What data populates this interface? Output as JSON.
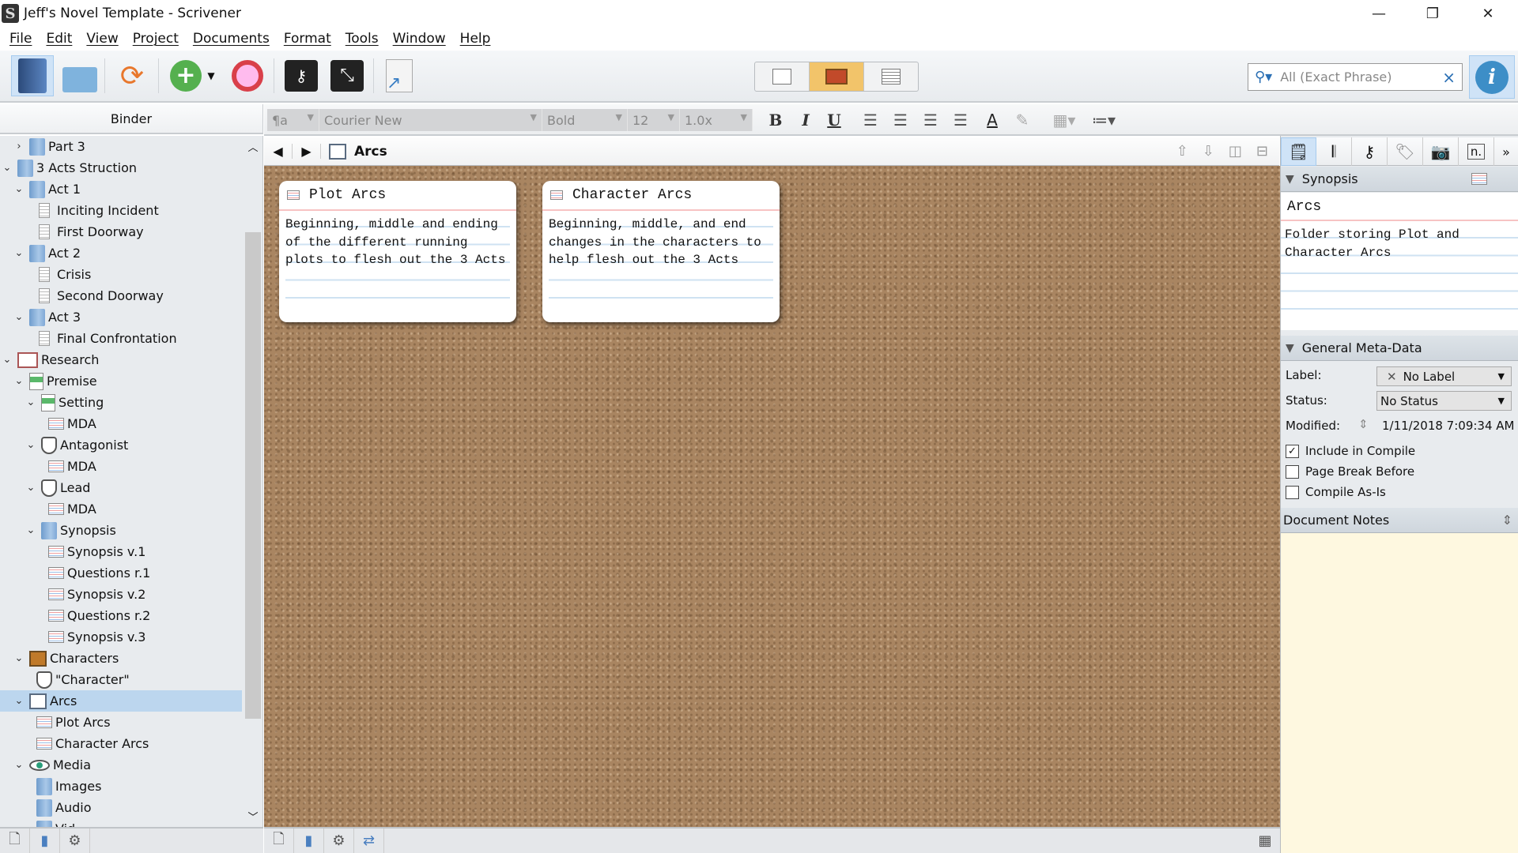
{
  "window": {
    "title": "Jeff's Novel Template - Scrivener",
    "minimize": "—",
    "restore": "❐",
    "close": "✕"
  },
  "menu": [
    "File",
    "Edit",
    "View",
    "Project",
    "Documents",
    "Format",
    "Tools",
    "Window",
    "Help"
  ],
  "toolbar": {
    "search_placeholder": "All (Exact Phrase)",
    "search_clear": "×",
    "info": "i"
  },
  "binder": {
    "header": "Binder",
    "items": [
      {
        "label": "Part 3",
        "level": 1,
        "arrow": ">",
        "icon": "folder"
      },
      {
        "label": "3 Acts Struction",
        "level": 0,
        "arrow": "v",
        "icon": "folder"
      },
      {
        "label": "Act 1",
        "level": 1,
        "arrow": "v",
        "icon": "folder"
      },
      {
        "label": "Inciting Incident",
        "level": 2,
        "icon": "doc"
      },
      {
        "label": "First Doorway",
        "level": 2,
        "icon": "doc"
      },
      {
        "label": "Act 2",
        "level": 1,
        "arrow": "v",
        "icon": "folder"
      },
      {
        "label": "Crisis",
        "level": 2,
        "icon": "doc"
      },
      {
        "label": "Second Doorway",
        "level": 2,
        "icon": "doc"
      },
      {
        "label": "Act 3",
        "level": 1,
        "arrow": "v",
        "icon": "folder"
      },
      {
        "label": "Final Confrontation",
        "level": 2,
        "icon": "doc"
      },
      {
        "label": "Research",
        "level": 0,
        "arrow": "v",
        "icon": "research"
      },
      {
        "label": "Premise",
        "level": 1,
        "arrow": "v",
        "icon": "pic"
      },
      {
        "label": "Setting",
        "level": 2,
        "arrow": "v",
        "icon": "pic"
      },
      {
        "label": "MDA",
        "level": 3,
        "icon": "card"
      },
      {
        "label": "Antagonist",
        "level": 2,
        "arrow": "v",
        "icon": "mask"
      },
      {
        "label": "MDA",
        "level": 3,
        "icon": "card"
      },
      {
        "label": "Lead",
        "level": 2,
        "arrow": "v",
        "icon": "mask"
      },
      {
        "label": "MDA",
        "level": 3,
        "icon": "card"
      },
      {
        "label": "Synopsis",
        "level": 2,
        "arrow": "v",
        "icon": "folder"
      },
      {
        "label": "Synopsis v.1",
        "level": 3,
        "icon": "card"
      },
      {
        "label": "Questions r.1",
        "level": 3,
        "icon": "card"
      },
      {
        "label": "Synopsis v.2",
        "level": 3,
        "icon": "card"
      },
      {
        "label": "Questions r.2",
        "level": 3,
        "icon": "card"
      },
      {
        "label": "Synopsis v.3",
        "level": 3,
        "icon": "card"
      },
      {
        "label": "Characters",
        "level": 1,
        "arrow": "v",
        "icon": "person"
      },
      {
        "label": "\"Character\"",
        "level": 2,
        "icon": "mask"
      },
      {
        "label": "Arcs",
        "level": 1,
        "arrow": "v",
        "icon": "chart",
        "selected": true
      },
      {
        "label": "Plot Arcs",
        "level": 2,
        "icon": "card"
      },
      {
        "label": "Character Arcs",
        "level": 2,
        "icon": "card"
      },
      {
        "label": "Media",
        "level": 1,
        "arrow": "v",
        "icon": "eye"
      },
      {
        "label": "Images",
        "level": 2,
        "icon": "folder"
      },
      {
        "label": "Audio",
        "level": 2,
        "icon": "folder"
      },
      {
        "label": "Vid",
        "level": 2,
        "icon": "folder"
      }
    ]
  },
  "format": {
    "style": "¶a",
    "font": "Courier New",
    "weight": "Bold",
    "size": "12",
    "spacing": "1.0x",
    "bold": "B",
    "italic": "I",
    "underline": "U"
  },
  "editor": {
    "title": "Arcs",
    "cards": [
      {
        "title": "Plot Arcs",
        "text": "Beginning, middle and ending of the different running plots to flesh out the 3 Acts"
      },
      {
        "title": "Character Arcs",
        "text": "Beginning, middle, and end changes in the characters to help flesh out the 3 Acts"
      }
    ]
  },
  "inspector": {
    "synopsis_header": "Synopsis",
    "synopsis_title": "Arcs",
    "synopsis_text": "Folder storing Plot and Character Arcs",
    "meta_header": "General Meta-Data",
    "label_label": "Label:",
    "label_value": "No Label",
    "status_label": "Status:",
    "status_value": "No Status",
    "modified_label": "Modified:",
    "modified_value": "1/11/2018 7:09:34 AM",
    "checks": [
      {
        "label": "Include in Compile",
        "checked": true
      },
      {
        "label": "Page Break Before",
        "checked": false
      },
      {
        "label": "Compile As-Is",
        "checked": false
      }
    ],
    "notes_header": "Document Notes",
    "notes_color": "#fef8e0"
  },
  "colors": {
    "selection": "#bcd6ee",
    "viewmode_active": "#f2c46a",
    "cork": "#a98561"
  }
}
